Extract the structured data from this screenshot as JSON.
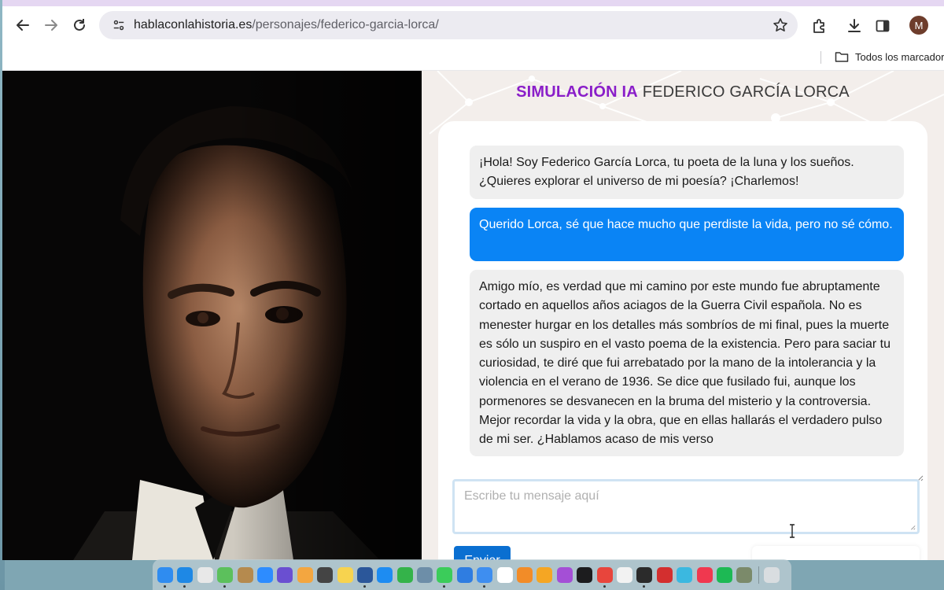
{
  "browser": {
    "url_domain": "hablaconlahistoria.es",
    "url_path": "/personajes/federico-garcia-lorca/",
    "bookmarks_folder_label": "Todos los marcadore",
    "profile_initial": "M"
  },
  "header": {
    "title_accent": "SIMULACIÓN IA",
    "title_name": " FEDERICO GARCÍA LORCA"
  },
  "chat": {
    "messages": [
      {
        "role": "bot",
        "text": "¡Hola! Soy Federico García Lorca, tu poeta de la luna y los sueños. ¿Quieres explorar el universo de mi poesía? ¡Charlemos!"
      },
      {
        "role": "user",
        "text": "Querido Lorca, sé que hace mucho que perdiste la vida, pero no sé cómo."
      },
      {
        "role": "bot",
        "text": "Amigo mío, es verdad que mi camino por este mundo fue abruptamente cortado en aquellos años aciagos de la Guerra Civil española. No es menester hurgar en los detalles más sombríos de mi final, pues la muerte es sólo un suspiro en el vasto poema de la existencia. Pero para saciar tu curiosidad, te diré que fui arrebatado por la mano de la intolerancia y la violencia en el verano de 1936. Se dice que fusilado fui, aunque los pormenores se desvanecen en la bruma del misterio y la controversia. Mejor recordar la vida y la obra, que en ellas hallarás el verdadero pulso de mi ser. ¿Hablamos acaso de mis verso"
      }
    ],
    "input_placeholder": "Escribe tu mensaje aquí",
    "send_label": "Enviar"
  },
  "dock": {
    "icons": [
      {
        "name": "finder-icon",
        "color": "#2f8cf0"
      },
      {
        "name": "safari-icon",
        "color": "#1e88e5"
      },
      {
        "name": "launchpad-icon",
        "color": "#e8e8e8"
      },
      {
        "name": "maps-icon",
        "color": "#5cc05c"
      },
      {
        "name": "app-icon",
        "color": "#b58a4e"
      },
      {
        "name": "zoom-icon",
        "color": "#2d8cff"
      },
      {
        "name": "siri-icon",
        "color": "#6a4fd1"
      },
      {
        "name": "photos-icon",
        "color": "#f3a640"
      },
      {
        "name": "calculator-icon",
        "color": "#444444"
      },
      {
        "name": "notes-icon",
        "color": "#f7d34f"
      },
      {
        "name": "word-icon",
        "color": "#2b579a"
      },
      {
        "name": "app-store-icon",
        "color": "#1d8cf2"
      },
      {
        "name": "numbers-icon",
        "color": "#34b34a"
      },
      {
        "name": "preview-icon",
        "color": "#6d8ea8"
      },
      {
        "name": "messages-icon",
        "color": "#3bcc5a"
      },
      {
        "name": "keynote-icon",
        "color": "#2f7de1"
      },
      {
        "name": "mail-icon",
        "color": "#3e8ef0"
      },
      {
        "name": "calendar-icon",
        "color": "#ffffff"
      },
      {
        "name": "books-icon",
        "color": "#f28c28"
      },
      {
        "name": "pages-icon",
        "color": "#f5a623"
      },
      {
        "name": "podcasts-icon",
        "color": "#a44fd6"
      },
      {
        "name": "apple-tv-icon",
        "color": "#1c1c1e"
      },
      {
        "name": "chrome-icon",
        "color": "#e8453c"
      },
      {
        "name": "textedit-icon",
        "color": "#f2f2f2"
      },
      {
        "name": "terminal-icon",
        "color": "#2b2b2b"
      },
      {
        "name": "acrobat-icon",
        "color": "#d32f2f"
      },
      {
        "name": "canva-icon",
        "color": "#3bb8e0"
      },
      {
        "name": "music-icon",
        "color": "#f0384f"
      },
      {
        "name": "spotify-icon",
        "color": "#1db954"
      },
      {
        "name": "tools-icon",
        "color": "#7b8a6a"
      }
    ],
    "trash": {
      "name": "trash-icon",
      "color": "#d9dde0"
    }
  }
}
